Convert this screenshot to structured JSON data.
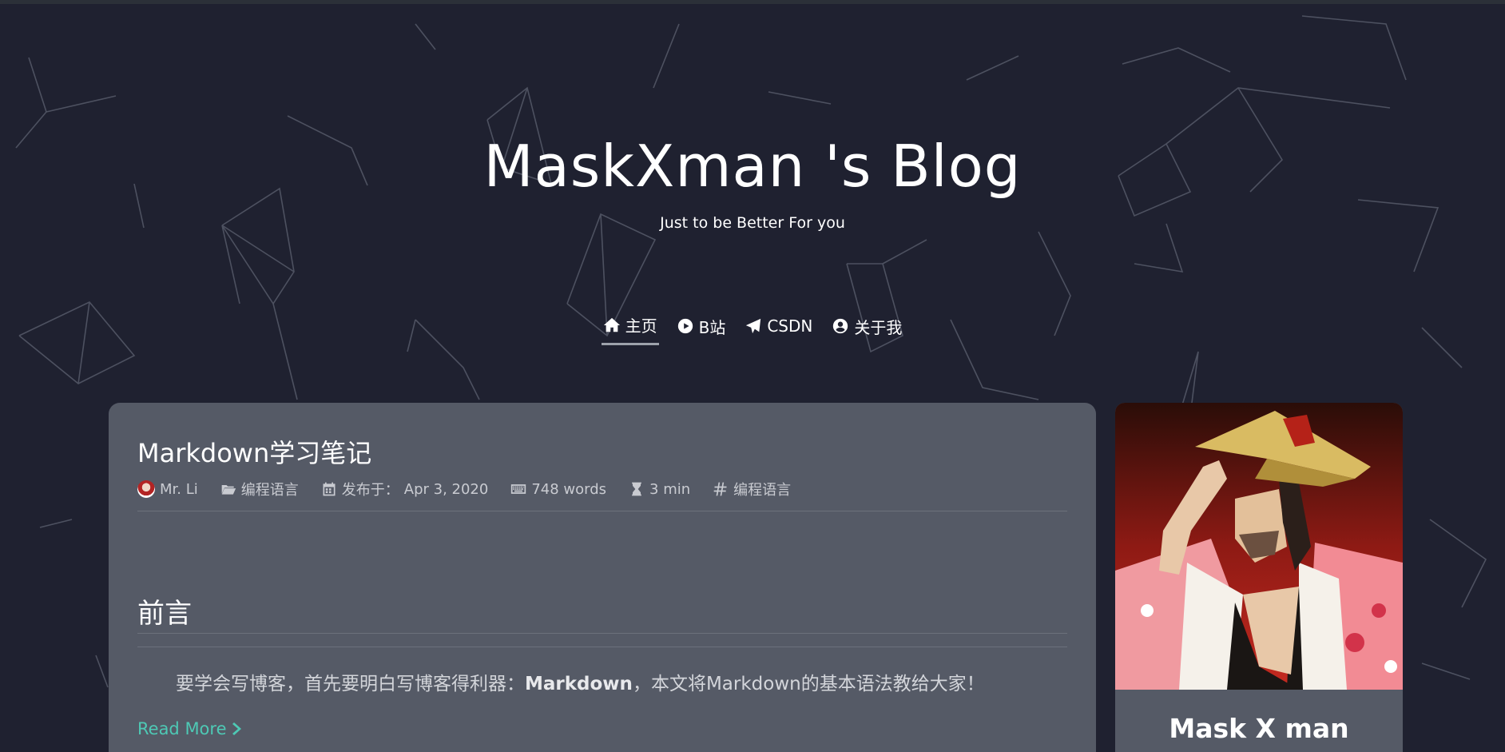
{
  "site": {
    "title": "MaskXman 's Blog",
    "subtitle": "Just to be Better For you"
  },
  "nav": {
    "items": [
      {
        "label": "主页",
        "icon": "home-icon",
        "active": true
      },
      {
        "label": "B站",
        "icon": "play-circle-icon",
        "active": false
      },
      {
        "label": "CSDN",
        "icon": "paper-plane-icon",
        "active": false
      },
      {
        "label": "关于我",
        "icon": "user-circle-icon",
        "active": false
      }
    ]
  },
  "post": {
    "title": "Markdown学习笔记",
    "meta": {
      "author": "Mr. Li",
      "category": "编程语言",
      "date_prefix": "发布于：",
      "date": "Apr 3, 2020",
      "words": "748 words",
      "read_time": "3 min",
      "tag": "编程语言"
    },
    "section_heading": "前言",
    "excerpt_before": "要学会写博客，首先要明白写博客得利器：",
    "excerpt_bold": "Markdown",
    "excerpt_after": "，本文将Markdown的基本语法教给大家！",
    "read_more": "Read More"
  },
  "profile": {
    "name": "Mask X man"
  },
  "colors": {
    "background": "#1f2130",
    "card": "#555a66",
    "accent": "#4ec9b5",
    "text": "#ffffff"
  }
}
